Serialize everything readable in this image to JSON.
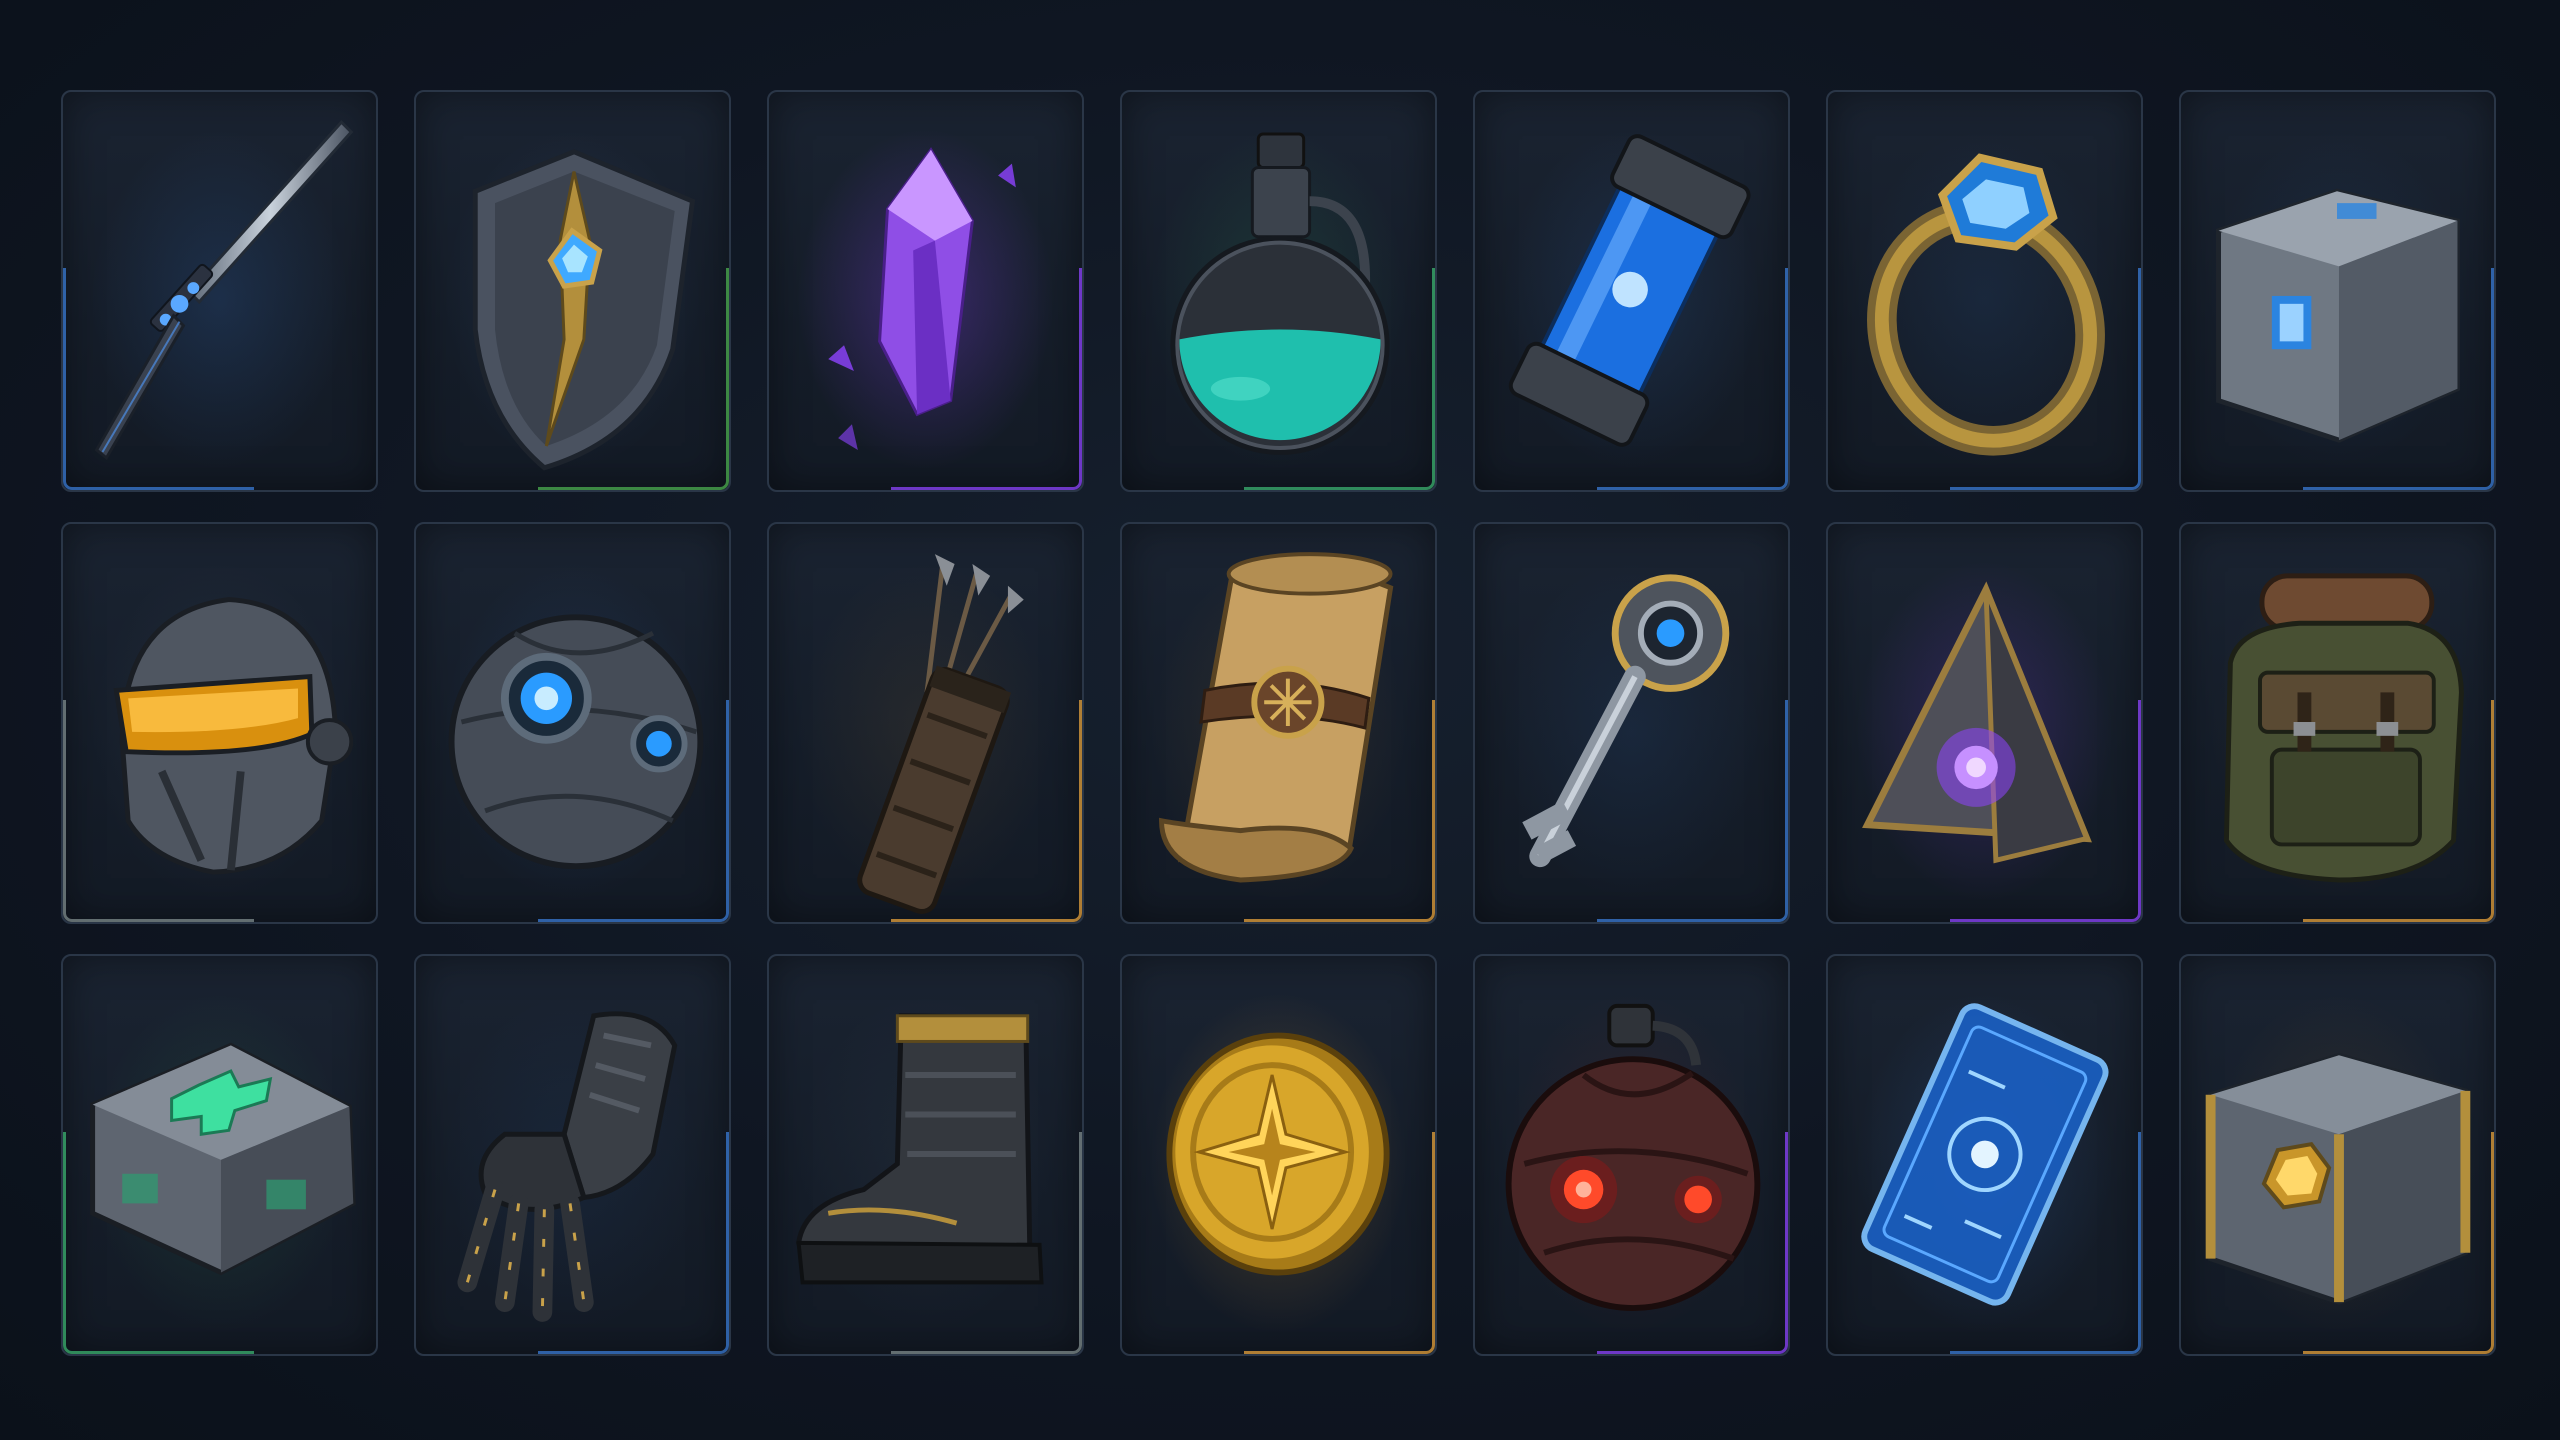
{
  "inventory": {
    "slots": [
      {
        "icon": "sword-icon",
        "rarity_color": "#3a7bd5"
      },
      {
        "icon": "shield-icon",
        "rarity_color": "#4caf50"
      },
      {
        "icon": "crystal-icon",
        "rarity_color": "#8e44ff"
      },
      {
        "icon": "potion-icon",
        "rarity_color": "#3cb371"
      },
      {
        "icon": "energy-cell-icon",
        "rarity_color": "#3a7bd5"
      },
      {
        "icon": "ring-icon",
        "rarity_color": "#3a7bd5"
      },
      {
        "icon": "tech-crate-icon",
        "rarity_color": "#3a7bd5"
      },
      {
        "icon": "helmet-icon",
        "rarity_color": "#7f8c8d"
      },
      {
        "icon": "orb-icon",
        "rarity_color": "#3a7bd5"
      },
      {
        "icon": "quiver-icon",
        "rarity_color": "#e6a23c"
      },
      {
        "icon": "scroll-icon",
        "rarity_color": "#e6a23c"
      },
      {
        "icon": "key-icon",
        "rarity_color": "#3a7bd5"
      },
      {
        "icon": "pyramid-artifact-icon",
        "rarity_color": "#8e44ff"
      },
      {
        "icon": "backpack-icon",
        "rarity_color": "#e6a23c"
      },
      {
        "icon": "medkit-icon",
        "rarity_color": "#3cb371"
      },
      {
        "icon": "gauntlet-icon",
        "rarity_color": "#3a7bd5"
      },
      {
        "icon": "boot-icon",
        "rarity_color": "#7f8c8d"
      },
      {
        "icon": "gold-coin-icon",
        "rarity_color": "#e6a23c"
      },
      {
        "icon": "grenade-icon",
        "rarity_color": "#8e44ff"
      },
      {
        "icon": "holo-card-icon",
        "rarity_color": "#3a7bd5"
      },
      {
        "icon": "gold-crate-icon",
        "rarity_color": "#e6a23c"
      }
    ]
  }
}
